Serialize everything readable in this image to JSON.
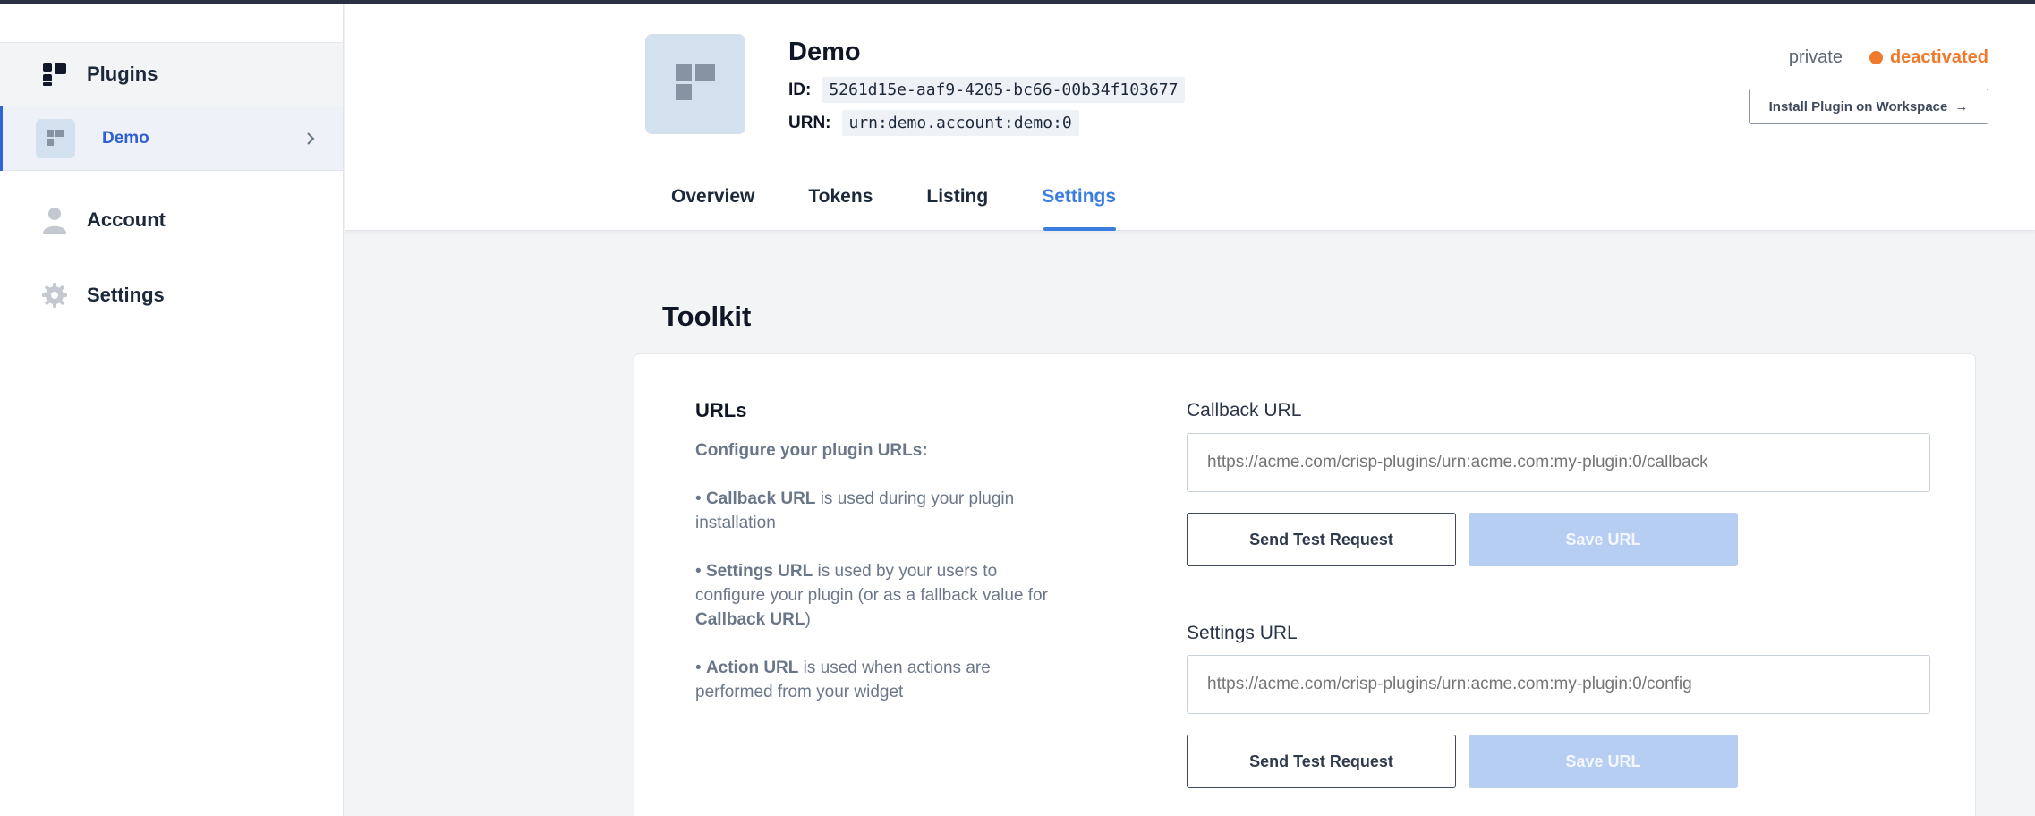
{
  "sidebar": {
    "items": [
      {
        "label": "Plugins",
        "icon": "plugins-grid-icon"
      },
      {
        "label": "Demo",
        "icon": "plugin-thumb-icon"
      },
      {
        "label": "Account",
        "icon": "user-icon"
      },
      {
        "label": "Settings",
        "icon": "gear-icon"
      }
    ]
  },
  "header": {
    "title": "Demo",
    "id_label": "ID:",
    "id_value": "5261d15e-aaf9-4205-bc66-00b34f103677",
    "urn_label": "URN:",
    "urn_value": "urn:demo.account:demo:0",
    "visibility": "private",
    "status": "deactivated",
    "status_color": "#f07a2b",
    "install_label": "Install Plugin on Workspace",
    "tabs": [
      {
        "label": "Overview"
      },
      {
        "label": "Tokens"
      },
      {
        "label": "Listing"
      },
      {
        "label": "Settings",
        "active": true
      }
    ]
  },
  "toolkit": {
    "title": "Toolkit",
    "urls_title": "URLs",
    "urls_subtitle": "Configure your plugin URLs:",
    "bullets": {
      "b1_bold": "Callback URL",
      "b1_text": " is used during your plugin installation",
      "b2_bold": "Settings URL",
      "b2_text": " is used by your users to configure your plugin (or as a fallback value for ",
      "b2_bold2": "Callback URL",
      "b2_end": ")",
      "b3_bold": "Action URL",
      "b3_text": " is used when actions are performed from your widget"
    },
    "callback": {
      "label": "Callback URL",
      "placeholder": "https://acme.com/crisp-plugins/urn:acme.com:my-plugin:0/callback",
      "test_label": "Send Test Request",
      "save_label": "Save URL"
    },
    "settings": {
      "label": "Settings URL",
      "placeholder": "https://acme.com/crisp-plugins/urn:acme.com:my-plugin:0/config",
      "test_label": "Send Test Request",
      "save_label": "Save URL"
    }
  },
  "colors": {
    "accent": "#3c7de0",
    "sidebar_active": "#2f5fd0",
    "status_deactivated": "#f07a2b",
    "save_disabled": "#b7cef3"
  }
}
